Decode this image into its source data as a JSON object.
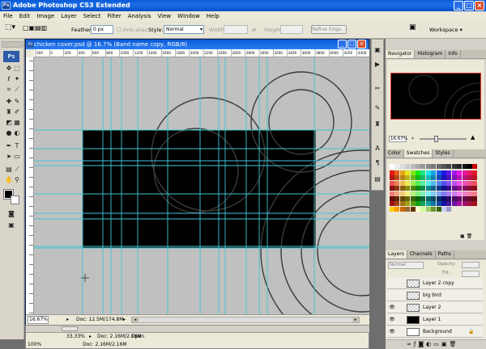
{
  "app": {
    "title": "Adobe Photoshop CS3 Extended",
    "logo": "Ps"
  },
  "menu": [
    "File",
    "Edit",
    "Image",
    "Layer",
    "Select",
    "Filter",
    "Analysis",
    "View",
    "Window",
    "Help"
  ],
  "options": {
    "feather_label": "Feather:",
    "feather_value": "0 px",
    "antialias_label": "Anti-alias",
    "style_label": "Style:",
    "style_value": "Normal",
    "width_label": "Width:",
    "height_label": "Height:",
    "refine_edge": "Refine Edge...",
    "workspace": "Workspace ▾"
  },
  "document": {
    "title": "chicken cover.psd @ 16.7% (Band name copy, RGB/8)",
    "zoom": "16.67%",
    "doc_size": "Doc: 12.5M/174.8M",
    "ruler_ticks": [
      "200",
      "0",
      "200",
      "400",
      "600",
      "800",
      "1000",
      "1200",
      "1400",
      "1600",
      "1800",
      "2000",
      "2200",
      "2400",
      "2600",
      "2800",
      "3000",
      "3200",
      "3400",
      "3600",
      "3800",
      "4000",
      "4200",
      "4400"
    ]
  },
  "document2": {
    "zoom": "33.33%",
    "doc_size": "Doc: 2.16M/2.16M",
    "status": "Open",
    "zoom2": "100%"
  },
  "navigator": {
    "tabs": [
      "Navigator",
      "Histogram",
      "Info"
    ],
    "zoom": "16.67%"
  },
  "color_panel": {
    "tabs": [
      "Color",
      "Swatches",
      "Styles"
    ]
  },
  "layers_panel": {
    "tabs": [
      "Layers",
      "Channels",
      "Paths"
    ],
    "blend_mode": "Normal",
    "opacity_label": "Opacity:",
    "fill_label": "Fill:",
    "layers": [
      {
        "name": "Layer 2 copy",
        "visible": false
      },
      {
        "name": "big bird",
        "visible": false
      },
      {
        "name": "Layer 2",
        "visible": true
      },
      {
        "name": "Layer 1",
        "visible": true
      },
      {
        "name": "Background",
        "visible": true
      }
    ]
  },
  "colors": {
    "accent": "#0a5bd8",
    "guide": "#3fc6d4",
    "canvas_bg": "#c0c0c0",
    "image": "#000000"
  }
}
